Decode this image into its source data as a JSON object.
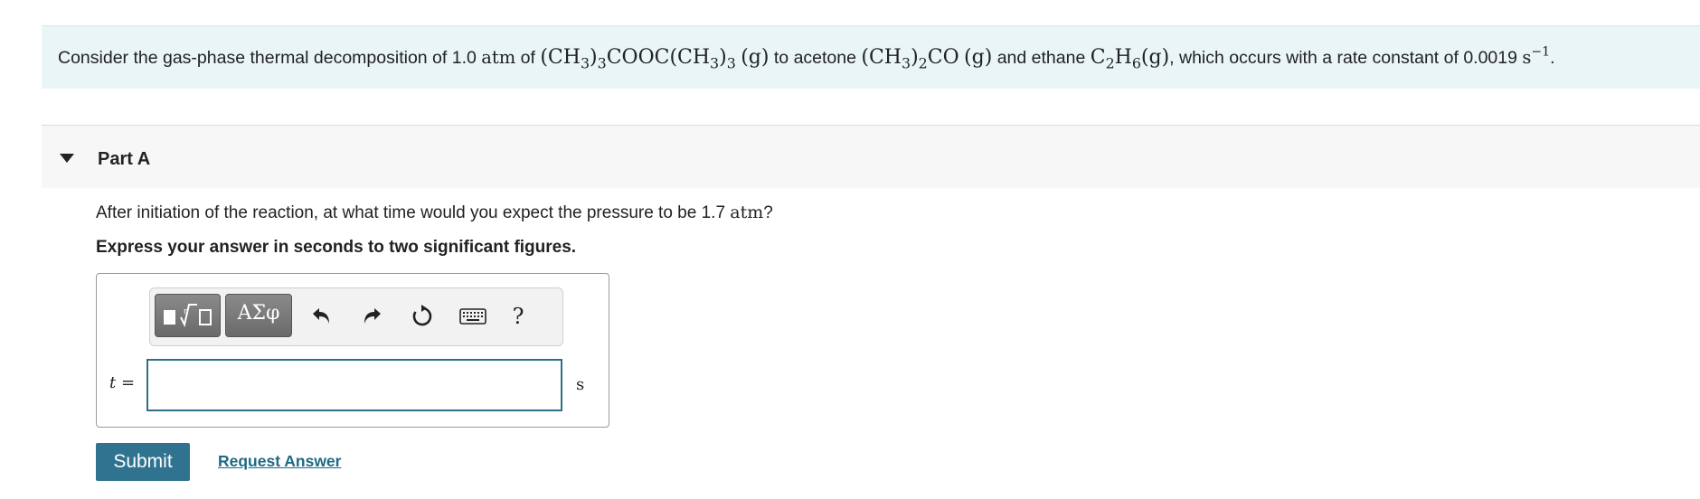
{
  "intro": {
    "t1": "Consider the gas-phase thermal decomposition of 1.0 ",
    "unit_atm": "atm",
    "t2": " of ",
    "reactant": "(CH3)3COOC(CH3)3",
    "phase": "(g)",
    "t3": " to acetone ",
    "acetone": "(CH3)2CO",
    "t4": " and ethane ",
    "ethane": "C2H6",
    "t5": ", which occurs with a rate constant of 0.0019 ",
    "rate_unit": "s",
    "rate_exp": "−1",
    "t6": "."
  },
  "part": {
    "title": "Part A",
    "question_pre": "After initiation of the reaction, at what time would you expect the pressure to be 1.7 ",
    "question_unit": "atm",
    "question_post": "?",
    "instruction": "Express your answer in seconds to two significant figures."
  },
  "toolbar": {
    "symbols_label": "ΑΣφ",
    "help_label": "?",
    "icons": [
      "templates-icon",
      "undo-icon",
      "redo-icon",
      "reset-icon",
      "keyboard-icon"
    ]
  },
  "answer": {
    "variable": "t",
    "equals": " =",
    "value": "",
    "unit": "s"
  },
  "actions": {
    "submit_label": "Submit",
    "request_label": "Request Answer"
  },
  "colors": {
    "intro_bg": "#eaf5f7",
    "accent": "#2f7390",
    "link": "#1d6a86"
  }
}
